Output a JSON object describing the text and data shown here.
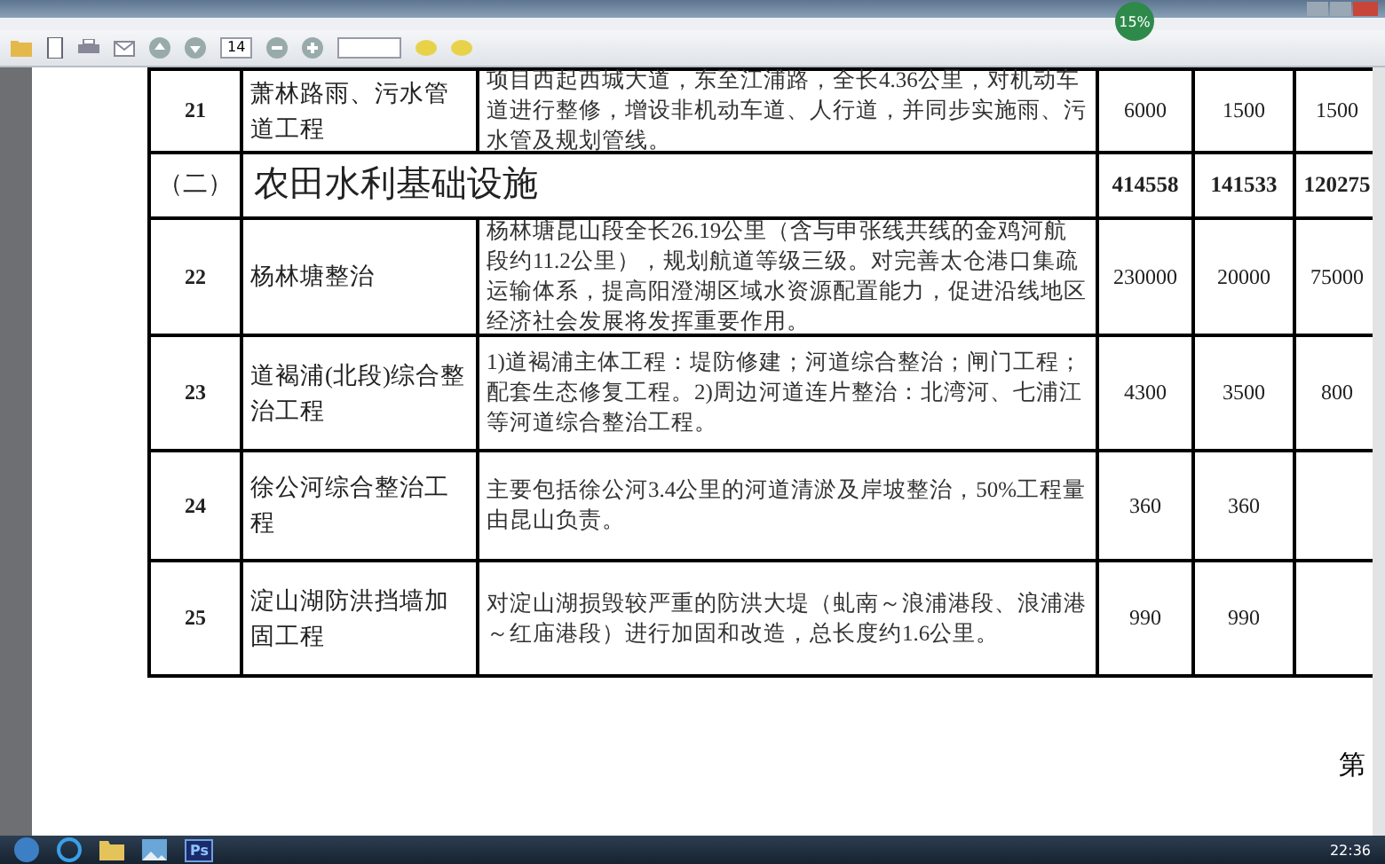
{
  "toolbar": {
    "page_number": "14"
  },
  "status_badge": {
    "text": "15%"
  },
  "table": {
    "rows": [
      {
        "kind": "item",
        "number": "21",
        "name": "萧林路雨、污水管道工程",
        "description": "项目西起西城大道，东至江浦路，全长4.36公里，对机动车道进行整修，增设非机动车道、人行道，并同步实施雨、污水管及规划管线。",
        "values": [
          "6000",
          "1500",
          "1500"
        ]
      },
      {
        "kind": "section",
        "number": "（二）",
        "name": "农田水利基础设施",
        "values": [
          "414558",
          "141533",
          "120275"
        ]
      },
      {
        "kind": "item",
        "number": "22",
        "name": "杨林塘整治",
        "description": "杨林塘昆山段全长26.19公里（含与申张线共线的金鸡河航段约11.2公里），规划航道等级三级。对完善太仓港口集疏运输体系，提高阳澄湖区域水资源配置能力，促进沿线地区经济社会发展将发挥重要作用。",
        "values": [
          "230000",
          "20000",
          "75000"
        ]
      },
      {
        "kind": "item",
        "number": "23",
        "name": "道褐浦(北段)综合整治工程",
        "description": "1)道褐浦主体工程：堤防修建；河道综合整治；闸门工程；配套生态修复工程。2)周边河道连片整治：北湾河、七浦江等河道综合整治工程。",
        "values": [
          "4300",
          "3500",
          "800"
        ]
      },
      {
        "kind": "item",
        "number": "24",
        "name": "徐公河综合整治工程",
        "description": "主要包括徐公河3.4公里的河道清淤及岸坡整治，50%工程量由昆山负责。",
        "values": [
          "360",
          "360"
        ]
      },
      {
        "kind": "item",
        "number": "25",
        "name": "淀山湖防洪挡墙加固工程",
        "description": "对淀山湖损毁较严重的防洪大堤（虬南～浪浦港段、浪浦港～红庙港段）进行加固和改造，总长度约1.6公里。",
        "values": [
          "990",
          "990"
        ]
      }
    ]
  },
  "page_footer": "第",
  "taskbar": {
    "app_icon_text": "Ps",
    "clock": "22:36"
  }
}
